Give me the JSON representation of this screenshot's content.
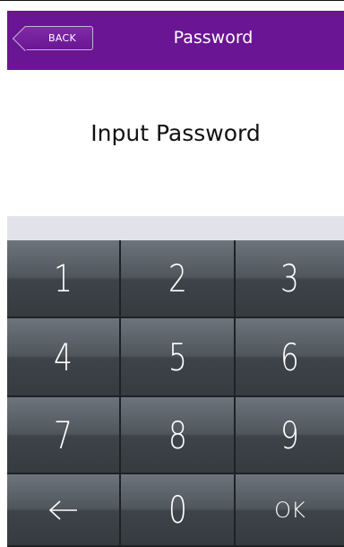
{
  "header": {
    "back_label": "BACK",
    "title": "Password"
  },
  "prompt": {
    "text": "Input Password"
  },
  "keypad": {
    "keys": [
      "1",
      "2",
      "3",
      "4",
      "5",
      "6",
      "7",
      "8",
      "9",
      "",
      "0",
      "OK"
    ],
    "backspace_icon": "left-arrow-icon"
  },
  "colors": {
    "header_bg": "#6a1594",
    "keypad_bg": "#4f565c"
  }
}
